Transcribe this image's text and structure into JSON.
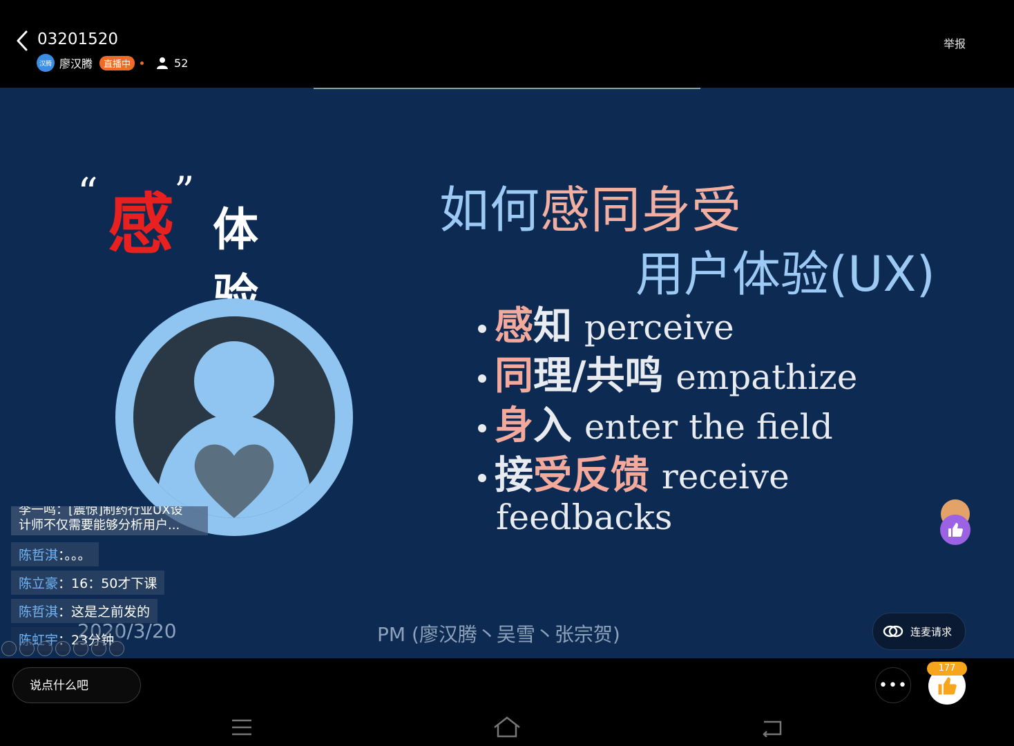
{
  "header": {
    "room_id": "03201520",
    "host_name": "廖汉腾",
    "avatar_text": "汉腾",
    "live_badge": "直播中",
    "viewer_count": "52",
    "report_label": "举报"
  },
  "slide": {
    "title_quote_open": "“",
    "title_char": "感",
    "title_quote_close": "”",
    "title_suffix": "体验",
    "main_title_parts": [
      "如何",
      "感同身受"
    ],
    "subtitle": "用户体验(UX)",
    "bullets": [
      {
        "cn_parts": [
          {
            "text": "感",
            "color": "pink"
          },
          {
            "text": "知",
            "color": "white"
          }
        ],
        "en": "perceive"
      },
      {
        "cn_parts": [
          {
            "text": "同",
            "color": "pink"
          },
          {
            "text": "理/共鸣",
            "color": "white"
          }
        ],
        "en": "empathize"
      },
      {
        "cn_parts": [
          {
            "text": "身",
            "color": "pink"
          },
          {
            "text": "入",
            "color": "white"
          }
        ],
        "en": "enter the field"
      },
      {
        "cn_parts": [
          {
            "text": "接",
            "color": "white"
          },
          {
            "text": "受反馈",
            "color": "pink"
          }
        ],
        "en": "receive"
      }
    ],
    "bullet_continuation": "feedbacks",
    "footer": "PM (廖汉腾丶吴雪丶张宗贺)",
    "date": "2020/3/20"
  },
  "chat": {
    "first_message_line1": "李一鸣：[震惊]制药行业UX设",
    "first_message_line2": "计师不仅需要能够分析用户...",
    "messages": [
      {
        "name": "陈哲淇",
        "sep": "：",
        "text": "。。。"
      },
      {
        "name": "陈立豪",
        "sep": "：",
        "text": "16：50才下课"
      },
      {
        "name": "陈哲淇",
        "sep": "：",
        "text": "这是之前发的"
      },
      {
        "name": "陈虹宇",
        "sep": "：",
        "text": "23分钟"
      }
    ]
  },
  "controls": {
    "mic_request_label": "连麦请求",
    "comment_placeholder": "说点什么吧",
    "more_label": "•••",
    "like_count": "177"
  },
  "colors": {
    "slide_bg": "#0d2a52",
    "live_badge": "#f06a28",
    "highlight_red": "#e82020",
    "title_blue": "#9ccaf4",
    "title_pink": "#f2aea0",
    "like_count_bg": "#f7a51c"
  },
  "icons": {
    "back": "chevron-left-icon",
    "viewer": "person-icon",
    "mic_request": "link-icon",
    "like": "thumbs-up-icon",
    "nav_menu": "menu-icon",
    "nav_home": "home-icon",
    "nav_back": "back-icon"
  }
}
